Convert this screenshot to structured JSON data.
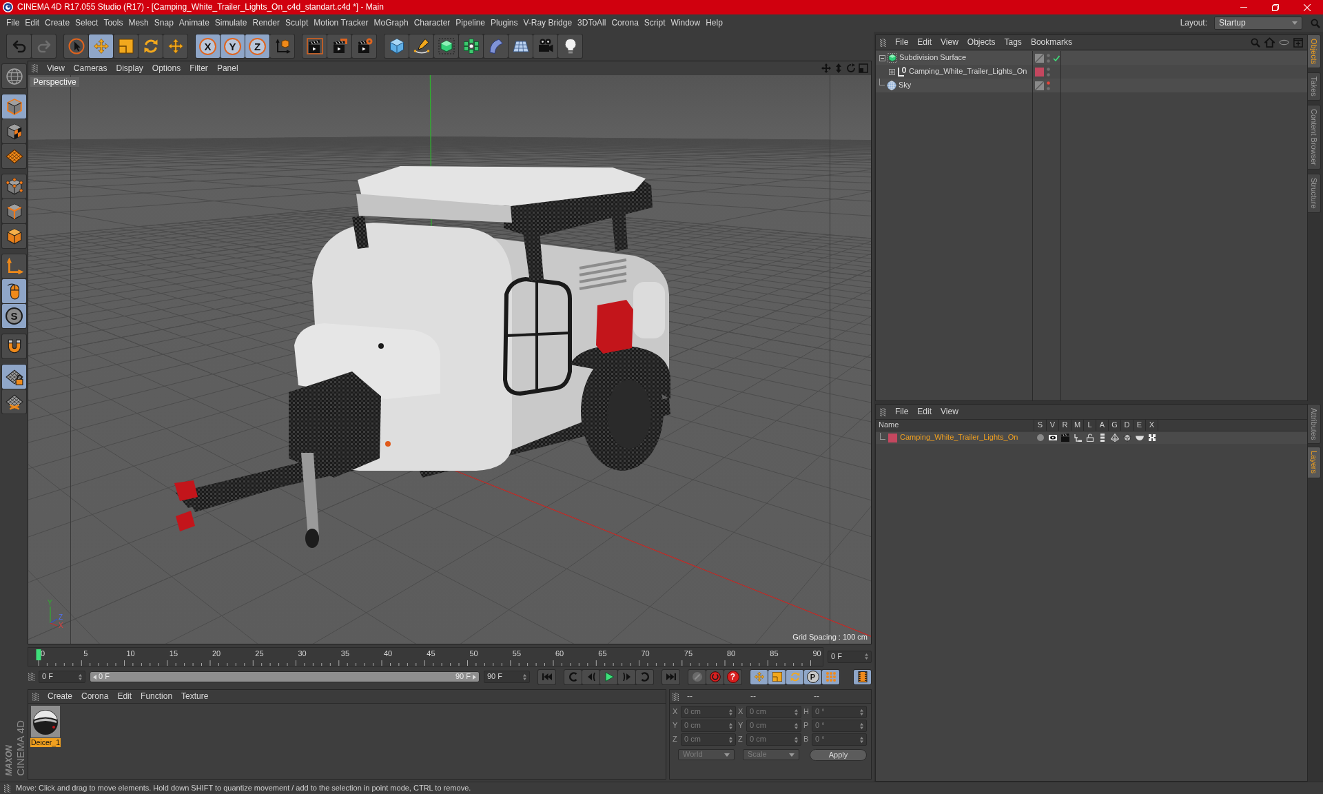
{
  "window": {
    "title": "CINEMA 4D R17.055 Studio (R17) - [Camping_White_Trailer_Lights_On_c4d_standart.c4d *] - Main"
  },
  "menu_bar": [
    "File",
    "Edit",
    "Create",
    "Select",
    "Tools",
    "Mesh",
    "Snap",
    "Animate",
    "Simulate",
    "Render",
    "Sculpt",
    "Motion Tracker",
    "MoGraph",
    "Character",
    "Pipeline",
    "Plugins",
    "V-Ray Bridge",
    "3DToAll",
    "Corona",
    "Script",
    "Window",
    "Help"
  ],
  "layout": {
    "label": "Layout:",
    "value": "Startup"
  },
  "toolbar": [
    {
      "tools": [
        {
          "kind": "undo",
          "selected": false,
          "disabled": false
        },
        {
          "kind": "redo",
          "selected": false,
          "disabled": true
        }
      ]
    },
    {
      "tools": [
        {
          "kind": "select",
          "selected": false
        },
        {
          "kind": "move",
          "selected": true
        },
        {
          "kind": "scale",
          "selected": false
        },
        {
          "kind": "rotate",
          "selected": false
        },
        {
          "kind": "transform",
          "selected": false
        }
      ]
    },
    {
      "tools": [
        {
          "kind": "axis",
          "label": "X",
          "selected": true
        },
        {
          "kind": "axis",
          "label": "Y",
          "selected": true
        },
        {
          "kind": "axis",
          "label": "Z",
          "selected": true
        },
        {
          "kind": "coords",
          "selected": false
        }
      ]
    },
    {
      "tools": [
        {
          "kind": "renderview",
          "selected": false
        },
        {
          "kind": "renderpicture",
          "selected": false
        },
        {
          "kind": "rendersettings",
          "selected": false
        }
      ]
    },
    {
      "tools": [
        {
          "kind": "cube",
          "selected": false
        },
        {
          "kind": "pen",
          "selected": false
        },
        {
          "kind": "subdivision",
          "selected": false
        },
        {
          "kind": "cloner",
          "selected": false
        },
        {
          "kind": "bend",
          "selected": false
        },
        {
          "kind": "floor",
          "selected": false
        },
        {
          "kind": "camera",
          "selected": false
        },
        {
          "kind": "light",
          "selected": false
        }
      ]
    }
  ],
  "left_toolbar": [
    {
      "tools": [
        {
          "kind": "makeeditable",
          "selected": false
        }
      ]
    },
    {
      "tools": [
        {
          "kind": "model",
          "selected": true
        },
        {
          "kind": "texture",
          "selected": false
        },
        {
          "kind": "workplane",
          "selected": false
        }
      ]
    },
    {
      "tools": [
        {
          "kind": "points",
          "selected": false
        },
        {
          "kind": "edges",
          "selected": false
        },
        {
          "kind": "polygons",
          "selected": false
        }
      ]
    },
    {
      "tools": [
        {
          "kind": "axismode",
          "selected": false
        },
        {
          "kind": "tweak",
          "selected": true
        },
        {
          "kind": "snap",
          "label": "S",
          "selected": true
        }
      ]
    },
    {
      "tools": [
        {
          "kind": "magnet",
          "selected": false
        }
      ]
    },
    {
      "tools": [
        {
          "kind": "planelock",
          "selected": true
        },
        {
          "kind": "planerotate",
          "selected": false
        }
      ]
    }
  ],
  "viewport": {
    "menu": [
      "View",
      "Cameras",
      "Display",
      "Options",
      "Filter",
      "Panel"
    ],
    "camera": "Perspective",
    "grid_spacing": "Grid Spacing : 100 cm",
    "axis_labels": [
      "Y",
      "Z",
      "X"
    ]
  },
  "object_manager": {
    "menu": [
      "File",
      "Edit",
      "View",
      "Objects",
      "Tags",
      "Bookmarks"
    ],
    "objects": [
      {
        "name": "Subdivision Surface",
        "kind": "subdivision",
        "expanded": true,
        "check": true,
        "hidden": false,
        "children": [
          {
            "name": "Camping_White_Trailer_Lights_On",
            "kind": "null",
            "expanded": false,
            "color": "#c4475f",
            "check": false,
            "hidden": false
          }
        ]
      },
      {
        "name": "Sky",
        "kind": "sky",
        "check": false,
        "hidden": true
      }
    ]
  },
  "side_tabs": [
    {
      "label": "Objects",
      "selected": true
    },
    {
      "label": "Takes",
      "selected": false
    },
    {
      "label": "Content Browser",
      "selected": false
    },
    {
      "label": "Structure",
      "selected": false
    }
  ],
  "layer_manager": {
    "menu": [
      "File",
      "Edit",
      "View"
    ],
    "columns": [
      "Name",
      "S",
      "V",
      "R",
      "M",
      "L",
      "A",
      "G",
      "D",
      "E",
      "X"
    ],
    "layers": [
      {
        "name": "Camping_White_Trailer_Lights_On",
        "color": "#c4475f",
        "selected": true
      }
    ]
  },
  "side_tabs_lower": [
    {
      "label": "Attributes",
      "selected": false
    },
    {
      "label": "Layers",
      "selected": true
    }
  ],
  "timeline": {
    "ruler_labels": [
      "0",
      "5",
      "10",
      "15",
      "20",
      "25",
      "30",
      "35",
      "40",
      "45",
      "50",
      "55",
      "60",
      "65",
      "70",
      "75",
      "80",
      "85",
      "90"
    ],
    "level": 0,
    "frame_field": "0 F"
  },
  "playback": {
    "start_field": "0 F",
    "range": {
      "start": "0 F",
      "end": "90 F"
    },
    "end_field": "90 F",
    "groups": [
      {
        "buttons": [
          {
            "kind": "gostart",
            "selected": false
          }
        ]
      },
      {
        "buttons": [
          {
            "kind": "prevkey",
            "selected": false
          },
          {
            "kind": "prevframe",
            "selected": false
          },
          {
            "kind": "play",
            "selected": false
          },
          {
            "kind": "nextframe",
            "selected": false
          },
          {
            "kind": "nextkey",
            "selected": false
          }
        ]
      },
      {
        "buttons": [
          {
            "kind": "goend",
            "selected": false
          }
        ]
      },
      {
        "buttons": [
          {
            "kind": "keyframe",
            "selected": false
          },
          {
            "kind": "record",
            "selected": false
          },
          {
            "kind": "help",
            "label": "?",
            "selected": false
          }
        ]
      },
      {
        "buttons": [
          {
            "kind": "move",
            "selected": true
          },
          {
            "kind": "scale",
            "selected": true
          },
          {
            "kind": "rotate",
            "selected": true
          },
          {
            "kind": "param",
            "label": "P",
            "selected": true
          },
          {
            "kind": "pla",
            "selected": true
          }
        ]
      },
      {
        "buttons": [
          {
            "kind": "timeline",
            "selected": true
          }
        ]
      }
    ]
  },
  "material_manager": {
    "menu": [
      "Create",
      "Corona",
      "Edit",
      "Function",
      "Texture"
    ],
    "materials": [
      {
        "name": "Deicer_1",
        "selected": true
      }
    ]
  },
  "coordinates": {
    "headers": [
      "--",
      "--",
      "--"
    ],
    "rows": [
      {
        "fields": [
          {
            "label": "X",
            "value": "0 cm"
          },
          {
            "label": "X",
            "value": "0 cm"
          },
          {
            "label": "H",
            "value": "0 °"
          }
        ]
      },
      {
        "fields": [
          {
            "label": "Y",
            "value": "0 cm"
          },
          {
            "label": "Y",
            "value": "0 cm"
          },
          {
            "label": "P",
            "value": "0 °"
          }
        ]
      },
      {
        "fields": [
          {
            "label": "Z",
            "value": "0 cm"
          },
          {
            "label": "Z",
            "value": "0 cm"
          },
          {
            "label": "B",
            "value": "0 °"
          }
        ]
      }
    ],
    "dropdowns": [
      "World",
      "Scale"
    ],
    "apply": "Apply"
  },
  "logo": {
    "brand": "MAXON",
    "product": "CINEMA 4D"
  },
  "status_bar": "Move: Click and drag to move elements. Hold down SHIFT to quantize movement / add to the selection in point mode, CTRL to remove."
}
